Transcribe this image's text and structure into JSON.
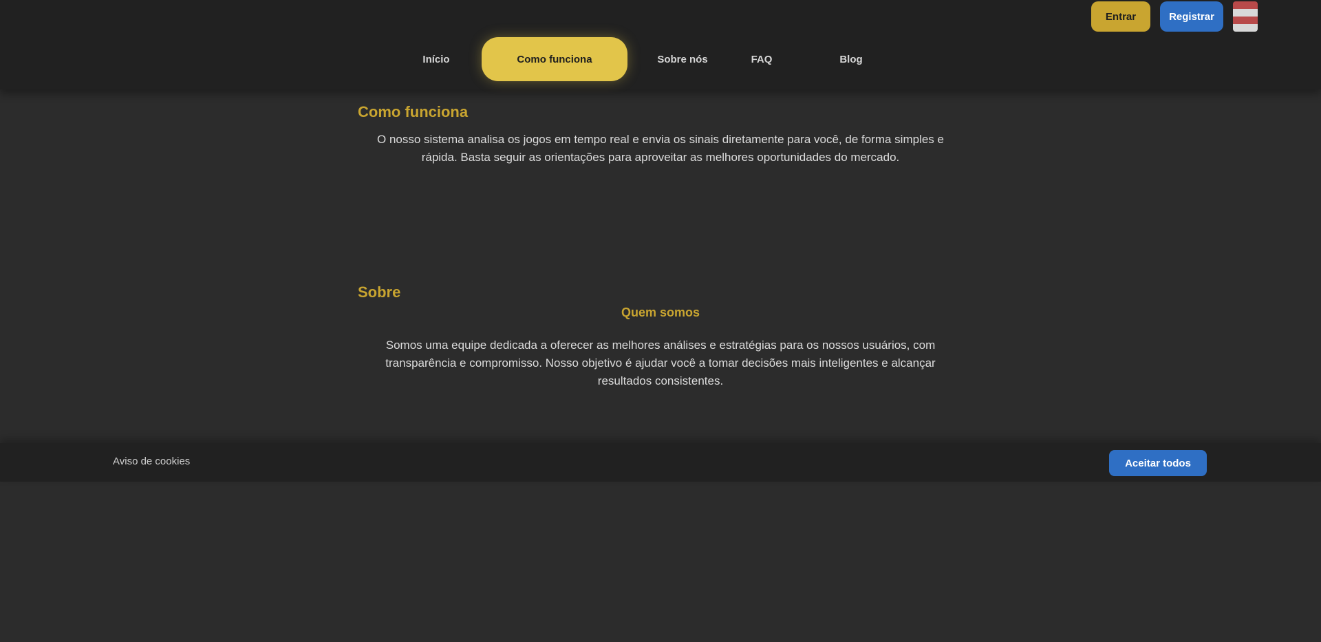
{
  "header": {
    "login_label": "Entrar",
    "register_label": "Registrar",
    "language_flag": "flag-icon"
  },
  "nav": {
    "items": [
      {
        "label": "Início"
      },
      {
        "label": "Como funciona"
      },
      {
        "label": "Sobre nós"
      },
      {
        "label": "FAQ"
      },
      {
        "label": "Blog"
      }
    ]
  },
  "main": {
    "section1": {
      "title": "Como funciona",
      "text": "O nosso sistema analisa os jogos em tempo real e envia os sinais diretamente para você, de forma simples e rápida. Basta seguir as orientações para aproveitar as melhores oportunidades do mercado."
    },
    "section2": {
      "title": "Sobre",
      "subtitle": "Quem somos",
      "text": "Somos uma equipe dedicada a oferecer as melhores análises e estratégias para os nossos usuários, com transparência e compromisso. Nosso objetivo é ajudar você a tomar decisões mais inteligentes e alcançar resultados consistentes."
    }
  },
  "footer": {
    "text": "Aviso de cookies",
    "button_label": "Aceitar todos"
  },
  "colors": {
    "accent": "#e2c54a",
    "gold_text": "#c9a530",
    "primary": "#2f6fc4",
    "background": "#2c2c2c",
    "header_bg": "#212121"
  }
}
